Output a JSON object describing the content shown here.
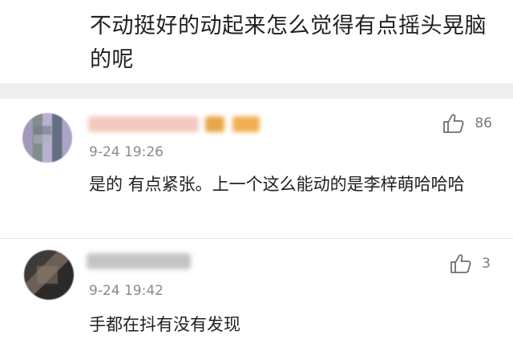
{
  "post": {
    "text": "不动挺好的动起来怎么觉得有点摇头晃脑的呢"
  },
  "comments": [
    {
      "time": "9-24 19:26",
      "text": "是的 有点紧张。上一个这么能动的是李梓萌哈哈哈",
      "likes": "86"
    },
    {
      "time": "9-24 19:42",
      "text": "手都在抖有没有发现",
      "likes": "3"
    }
  ],
  "icons": {
    "like": "thumbs-up-icon"
  },
  "colors": {
    "background": "#ffffff",
    "separator": "#eeeeee",
    "text": "#1f1f1f",
    "muted": "#8a8a8a"
  }
}
